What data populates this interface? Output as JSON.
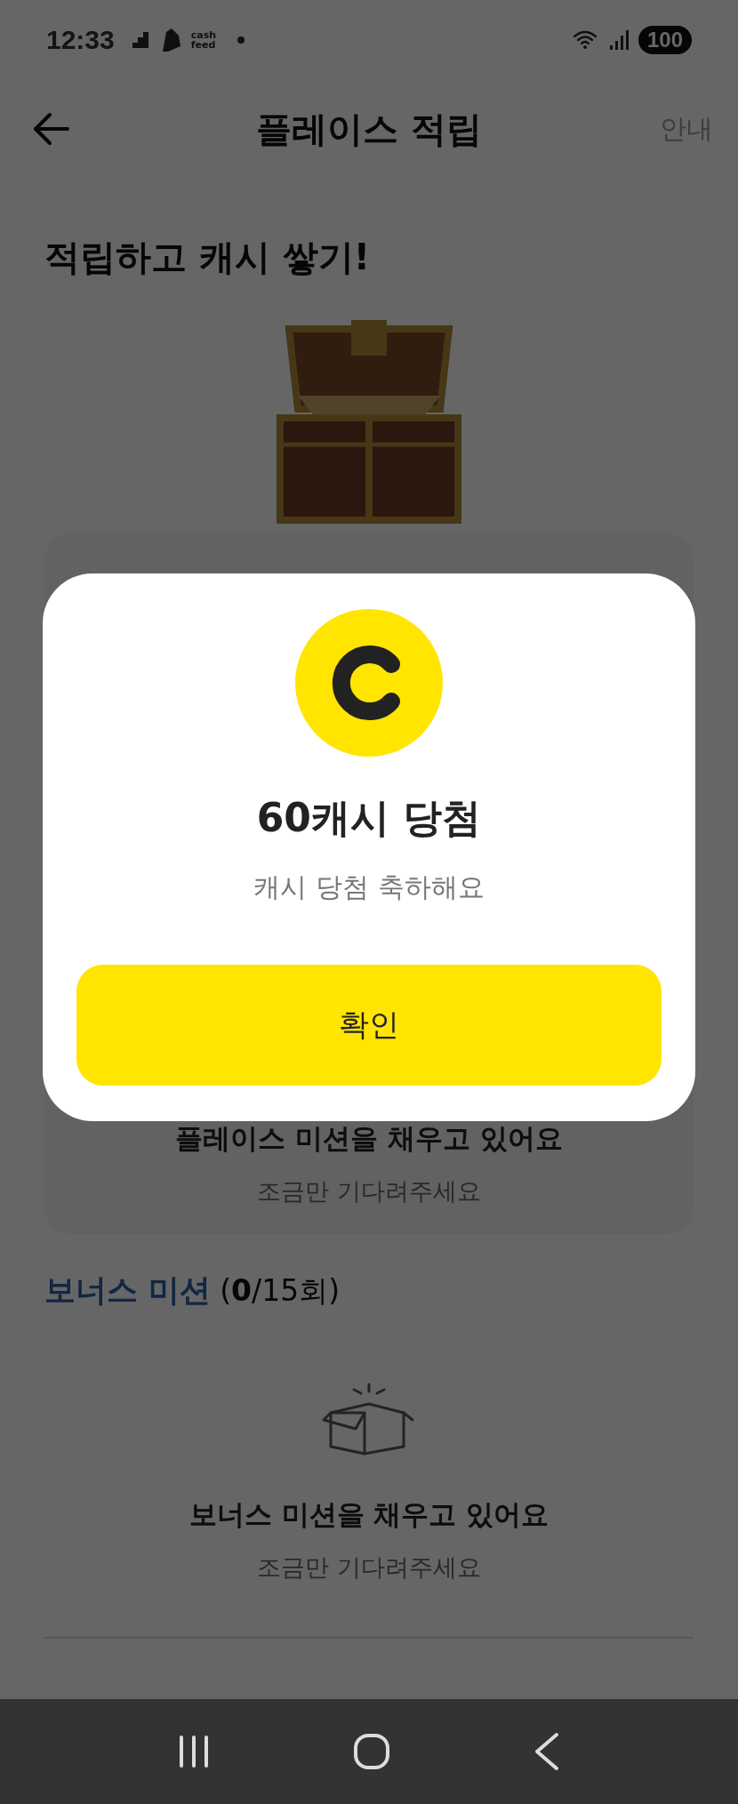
{
  "status_bar": {
    "time": "12:33",
    "app_label": "cash\nfeed",
    "battery": "100"
  },
  "header": {
    "title": "플레이스 적립",
    "action": "안내"
  },
  "headline": "적립하고 캐시 쌓기!",
  "place_mission": {
    "title": "플레이스 미션을 채우고 있어요",
    "subtitle": "조금만 기다려주세요"
  },
  "bonus_mission": {
    "title": "보너스 미션",
    "count": "(**0**/15회)",
    "empty_title": "보너스 미션을 채우고 있어요",
    "empty_subtitle": "조금만 기다려주세요"
  },
  "dialog": {
    "title": "60캐시 당첨",
    "message": "캐시 당첨 축하해요",
    "button": "확인"
  }
}
